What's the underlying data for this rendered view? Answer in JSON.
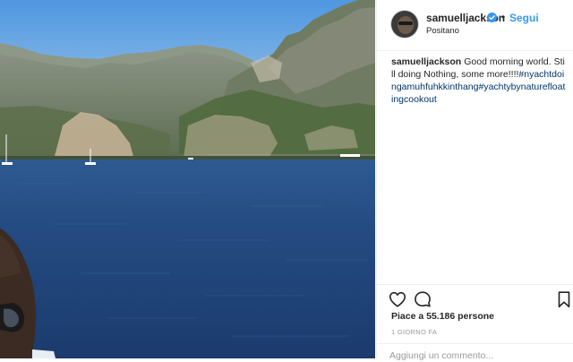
{
  "post": {
    "username": "samuelljackson",
    "follow_label": "Segui",
    "separator": "•",
    "location": "Positano",
    "caption": {
      "username": "samuelljackson",
      "text": "Good morning world. Still doing Nothing, some more!!!!",
      "hashtags": "#nyachtdoingamuhfuhkkinthang#yachtybynaturefloatingcookout"
    },
    "likes_text": "Piace a 55.186 persone",
    "time_text": "1 GIORNO FA",
    "comment_placeholder": "Aggiungi un commento..."
  },
  "icons": {
    "verified": "verified-badge-icon",
    "like": "heart-outline-icon",
    "comment": "comment-bubble-icon",
    "save": "bookmark-icon"
  },
  "colors": {
    "link_blue": "#3897f0",
    "hashtag_blue": "#003569",
    "muted_gray": "#999999",
    "text": "#262626",
    "sea": "#23457a"
  }
}
